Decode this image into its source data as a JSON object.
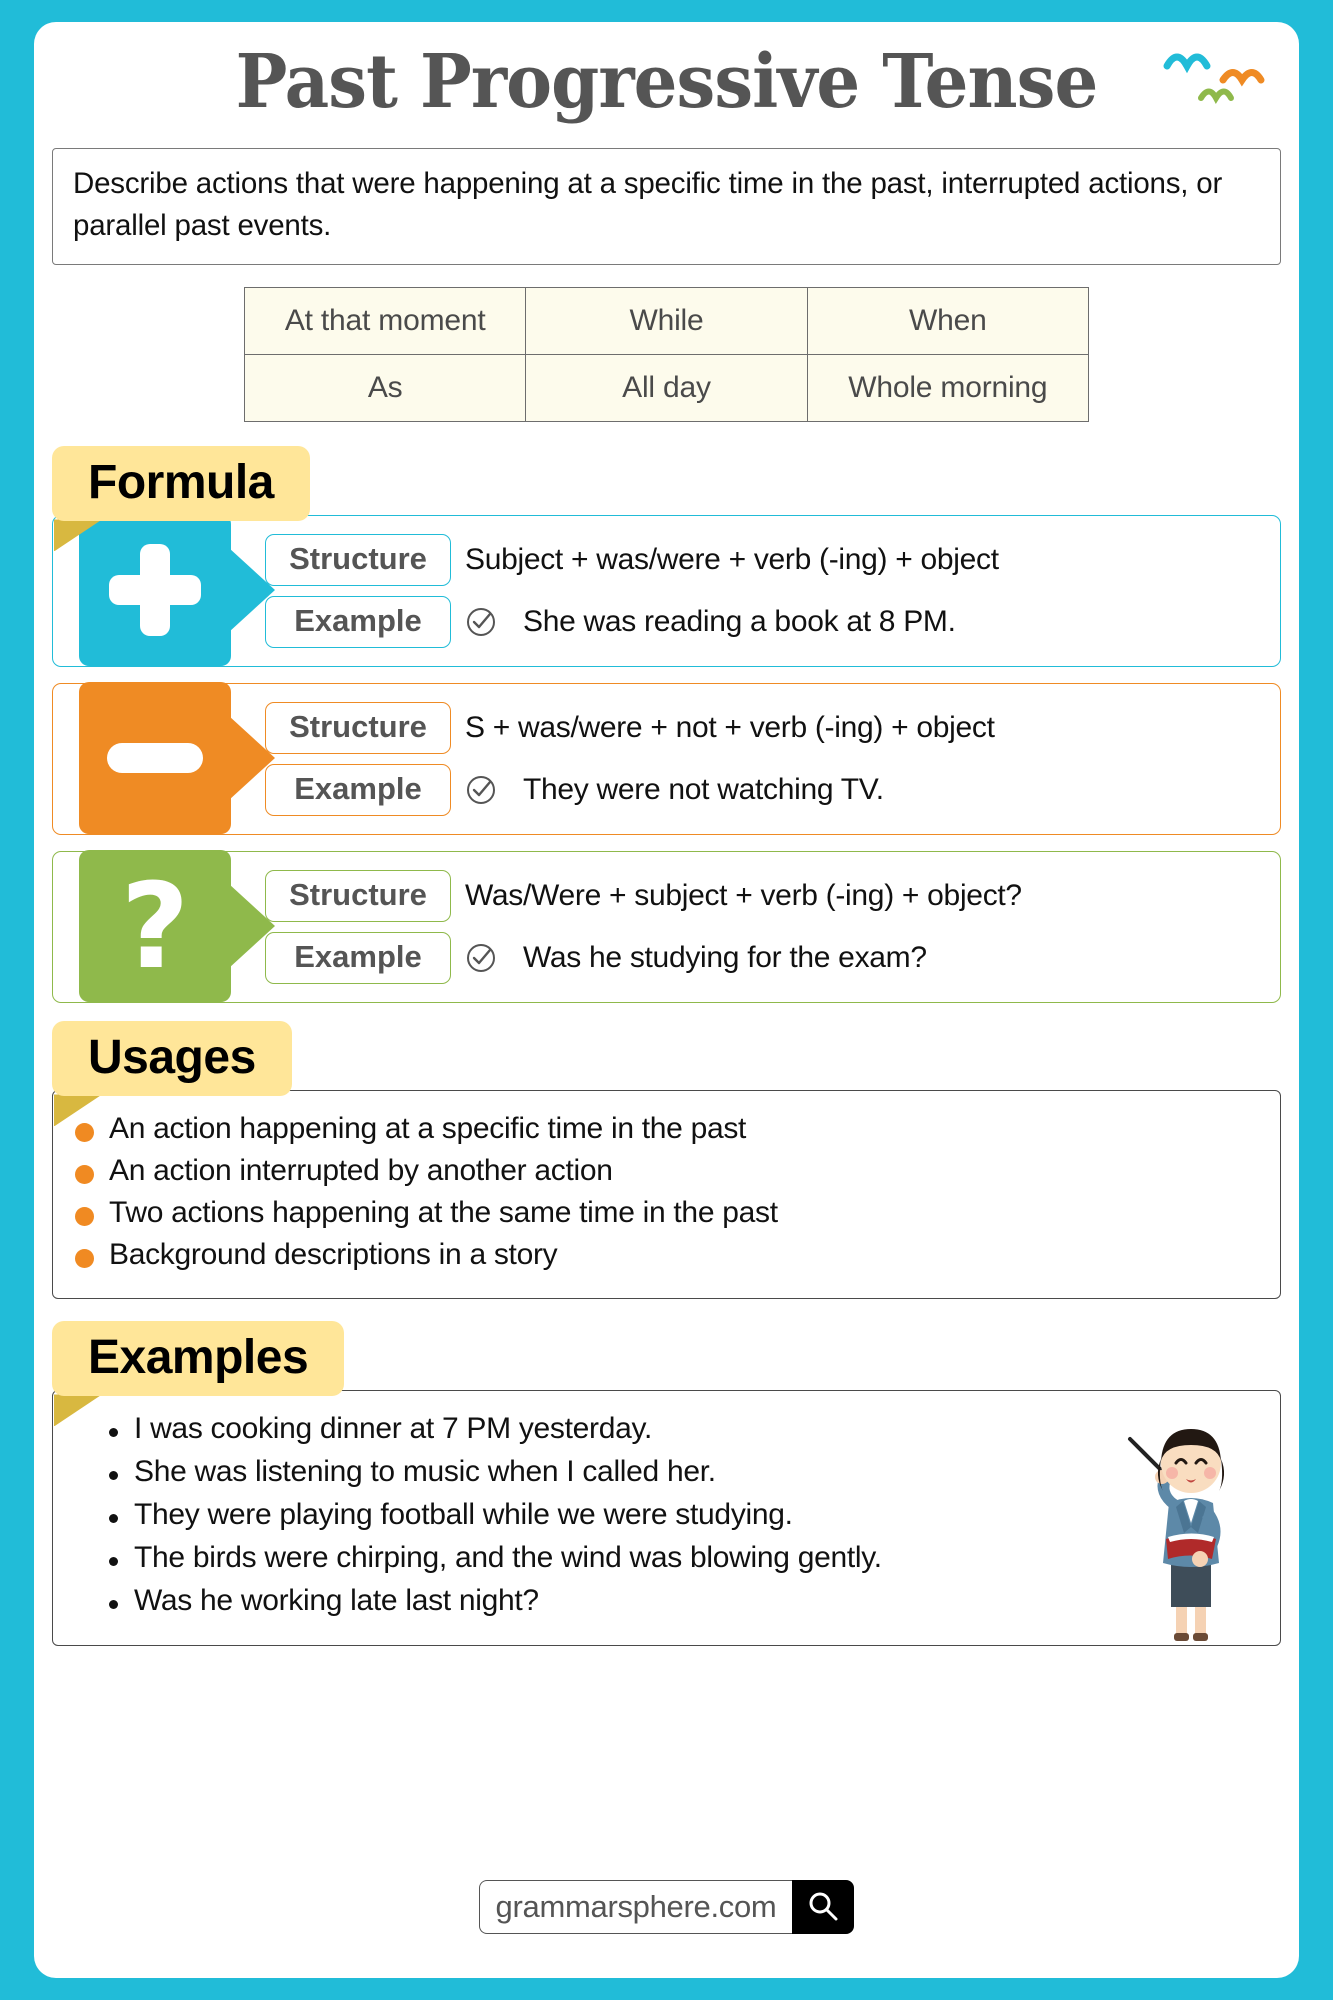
{
  "title": "Past Progressive Tense",
  "description": "Describe actions that were happening at a specific time in the past, interrupted actions, or parallel past events.",
  "signal_words": {
    "rows": [
      [
        "At that moment",
        "While",
        "When"
      ],
      [
        "As",
        "All day",
        "Whole morning"
      ]
    ]
  },
  "formula": {
    "heading": "Formula",
    "rows": [
      {
        "sign": "plus-icon",
        "accent": "#21bcd8",
        "structure_label": "Structure",
        "structure_text": "Subject + was/were + verb (-ing) + object",
        "example_label": "Example",
        "example_text": "She was reading a book at 8 PM."
      },
      {
        "sign": "minus-icon",
        "accent": "#ef8b24",
        "structure_label": "Structure",
        "structure_text": "S + was/were + not + verb (-ing) + object",
        "example_label": "Example",
        "example_text": "They were not watching TV."
      },
      {
        "sign": "question-icon",
        "accent": "#8fb94b",
        "structure_label": "Structure",
        "structure_text": "Was/Were + subject + verb (-ing) + object?",
        "example_label": "Example",
        "example_text": "Was he studying for the exam?"
      }
    ]
  },
  "usages": {
    "heading": "Usages",
    "items": [
      "An action happening at a specific time in the past",
      "An action interrupted by another action",
      "Two actions happening at the same time in the past",
      "Background descriptions in a story"
    ]
  },
  "examples": {
    "heading": "Examples",
    "items": [
      "I was cooking dinner at 7 PM yesterday.",
      "She was listening to music when I called her.",
      "They were playing football while we were studying.",
      "The birds were chirping, and the wind was blowing gently.",
      "Was he working late last night?"
    ]
  },
  "footer": {
    "site": "grammarsphere.com",
    "search_icon": "search-icon"
  },
  "colors": {
    "background": "#21bcd8",
    "tab": "#ffe699",
    "tab_fold": "#d8b840",
    "positive": "#21bcd8",
    "negative": "#ef8b24",
    "question": "#8fb94b",
    "bullet": "#f08a22",
    "table_cell": "#fdfbec"
  }
}
